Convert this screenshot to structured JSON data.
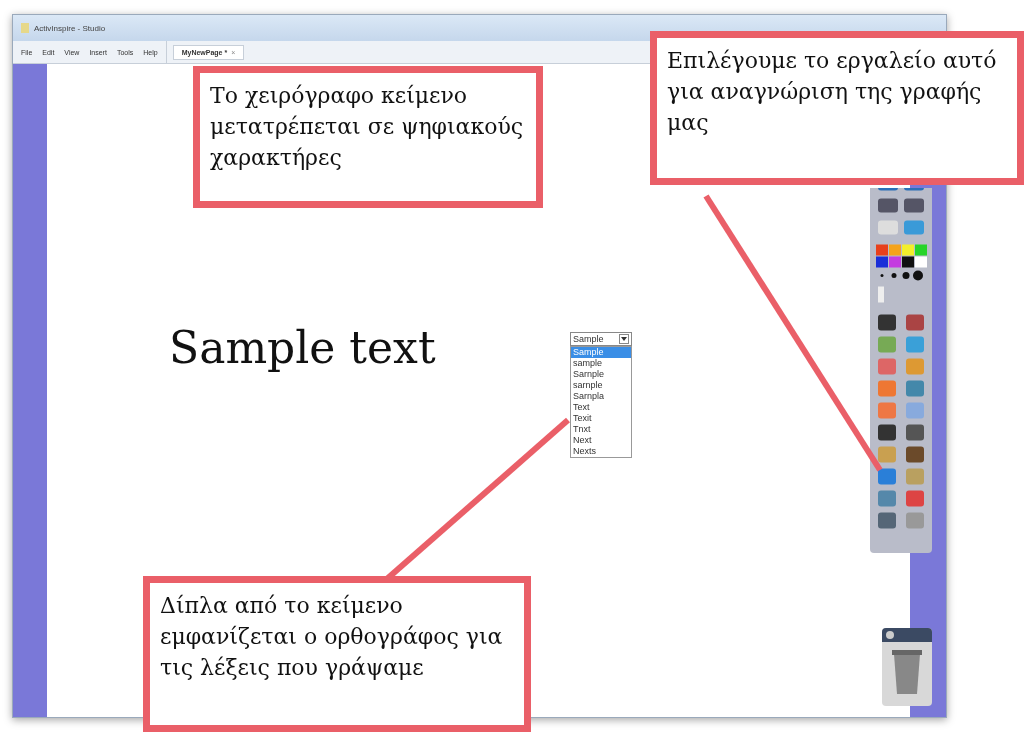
{
  "window": {
    "title": "ActivInspire - Studio"
  },
  "menu": [
    "File",
    "Edit",
    "View",
    "Insert",
    "Tools",
    "Help"
  ],
  "tabs": [
    {
      "label": "MyNewPage *",
      "close": "×",
      "selected": true
    }
  ],
  "canvas": {
    "text": "Sample text"
  },
  "suggestions": {
    "value": "Sample",
    "options": [
      {
        "label": "Sample",
        "selected": true
      },
      {
        "label": "sample",
        "selected": false
      },
      {
        "label": "Sarnple",
        "selected": false
      },
      {
        "label": "sarnple",
        "selected": false
      },
      {
        "label": "Sarnpla",
        "selected": false
      },
      {
        "label": "Text",
        "selected": false
      },
      {
        "label": "Texit",
        "selected": false
      },
      {
        "label": "Tnxt",
        "selected": false
      },
      {
        "label": "Next",
        "selected": false
      },
      {
        "label": "Nexts",
        "selected": false
      }
    ]
  },
  "callouts": [
    {
      "text": "Το χειρόγραφο κείμενο μετατρέπεται σε ψηφιακούς χαρακτήρες"
    },
    {
      "text": "Επιλέγουμε το εργαλείο αυτό για αναγνώριση της γραφής μας"
    },
    {
      "text": "Δίπλα από το κείμενο εμφανίζεται ο ορθογράφος για τις λέξεις που γράψαμε"
    }
  ]
}
